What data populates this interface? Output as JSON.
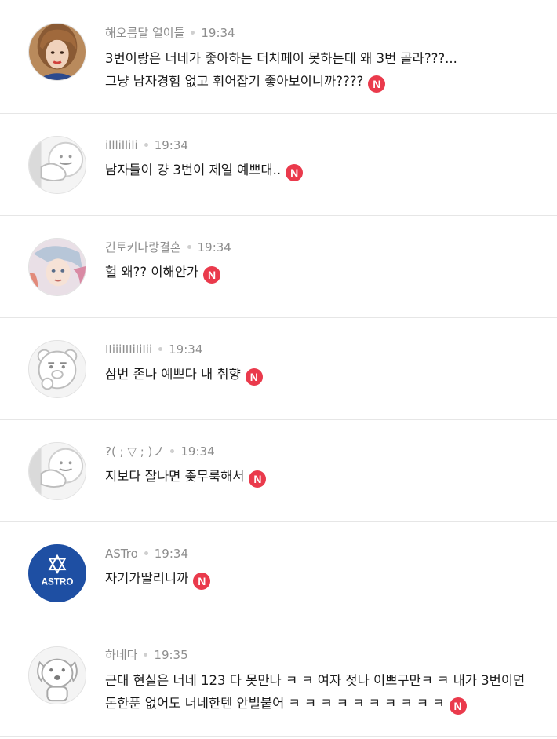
{
  "comments": [
    {
      "author": "해오름달 열이틀",
      "time": "19:34",
      "lines": [
        "3번이랑은 너네가 좋아하는 더치페이 못하는데 왜 3번 골라???...",
        "그냥 남자경험 없고 휘어잡기 좋아보이니까????"
      ],
      "badge": "N",
      "avatar": "avatar-photo-woman"
    },
    {
      "author": "illlillili",
      "time": "19:34",
      "lines": [
        "남자들이 걍 3번이 제일 예쁘대.."
      ],
      "badge": "N",
      "avatar": "avatar-default-character"
    },
    {
      "author": "긴토키나랑결혼",
      "time": "19:34",
      "lines": [
        "헐 왜?? 이해안가"
      ],
      "badge": "N",
      "avatar": "avatar-anime-illustration"
    },
    {
      "author": "IIiiiIIIiIiIii",
      "time": "19:34",
      "lines": [
        "삼번 존나 예쁘다 내 취향"
      ],
      "badge": "N",
      "avatar": "avatar-bear-character"
    },
    {
      "author": "?( ; ▽ ; )ノ",
      "time": "19:34",
      "lines": [
        "지보다 잘나면 좆무룩해서"
      ],
      "badge": "N",
      "avatar": "avatar-default-character"
    },
    {
      "author": "ASTro",
      "time": "19:34",
      "lines": [
        "자기가딸리니까"
      ],
      "badge": "N",
      "avatar": "avatar-astro-logo",
      "avatar_text": "ASTRO"
    },
    {
      "author": "하네다",
      "time": "19:35",
      "lines": [
        "근대 현실은 너네 123 다 못만나 ㅋ ㅋ 여자 젖나 이쁘구만ㅋ ㅋ 내가 3번이면",
        "돈한푼 없어도 너네한텐 안빌붙어 ㅋ ㅋ ㅋ ㅋ ㅋ ㅋ ㅋ ㅋ ㅋ ㅋ"
      ],
      "badge": "N",
      "avatar": "avatar-dog-character"
    }
  ],
  "colors": {
    "badge": "#ea3a4c",
    "meta_text": "#8e8e8e",
    "body_text": "#1a1a1a",
    "divider": "#e6e6e6",
    "astro_blue": "#1e4fa3"
  }
}
